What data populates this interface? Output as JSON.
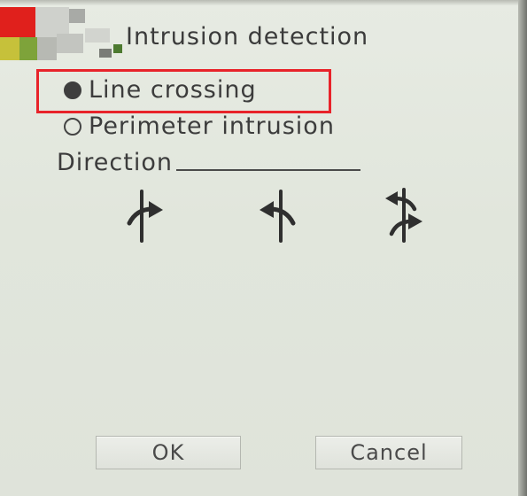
{
  "dialog": {
    "title": "Intrusion detection"
  },
  "mode": {
    "options": [
      {
        "label": "Line crossing",
        "selected": true
      },
      {
        "label": "Perimeter intrusion",
        "selected": false
      }
    ]
  },
  "direction": {
    "label": "Direction",
    "icons": [
      "cross-right-arrow-icon",
      "cross-left-arrow-icon",
      "cross-both-arrow-icon"
    ]
  },
  "buttons": {
    "ok_label": "OK",
    "cancel_label": "Cancel"
  },
  "colors": {
    "highlight": "#e8232a",
    "logo_red": "#e0201c",
    "logo_yellow": "#c6c13a",
    "logo_green": "#7ea33a",
    "text": "#3c3c3c"
  }
}
